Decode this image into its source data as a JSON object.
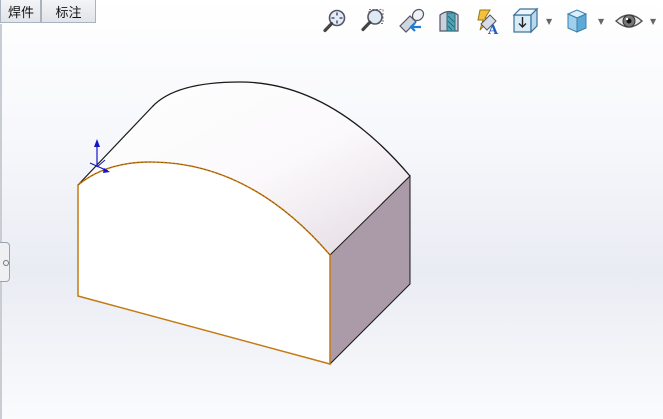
{
  "tabs": [
    {
      "label": "焊件"
    },
    {
      "label": "标注"
    }
  ],
  "toolbar": {
    "items": [
      {
        "icon": "zoom-to-fit-icon"
      },
      {
        "icon": "zoom-to-area-icon"
      },
      {
        "icon": "previous-view-icon"
      },
      {
        "icon": "section-view-icon"
      },
      {
        "icon": "dynamic-annotation-view-icon"
      },
      {
        "icon": "view-orientation-icon",
        "has_dropdown": true
      },
      {
        "icon": "display-style-icon",
        "has_dropdown": true
      },
      {
        "icon": "hide-show-items-icon",
        "has_dropdown": true
      }
    ]
  },
  "colors": {
    "face_front": "#ffffff",
    "face_side": "#ab9aa8",
    "selected_edge": "#c47a12",
    "model_edge": "#1a1a1a",
    "triad_axis": "#1414c8"
  }
}
